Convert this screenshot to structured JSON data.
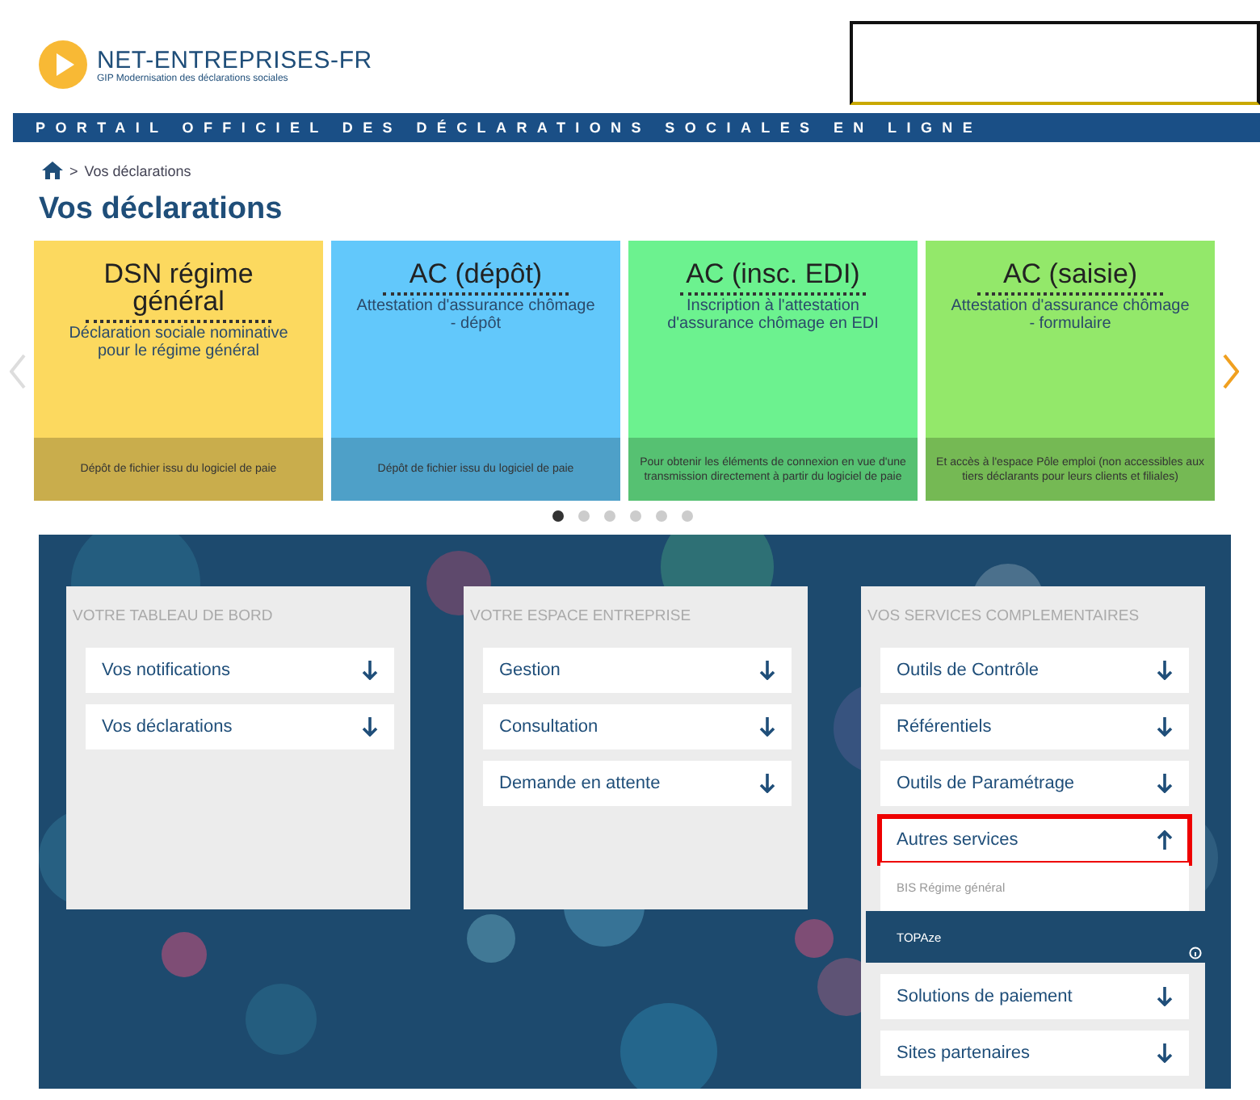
{
  "header": {
    "logo_title": "NET-ENTREPRISES-FR",
    "logo_subtitle": "GIP Modernisation des déclarations sociales",
    "banner": "PORTAIL OFFICIEL DES DÉCLARATIONS SOCIALES EN LIGNE"
  },
  "breadcrumb": {
    "separator": ">",
    "current": "Vos déclarations"
  },
  "page_title": "Vos déclarations",
  "cards": [
    {
      "title": "DSN régime général",
      "subtitle": "Déclaration sociale nominative pour le régime général",
      "footer": "Dépôt de fichier issu du logiciel de paie",
      "color": "#fcd95f"
    },
    {
      "title": "AC (dépôt)",
      "subtitle": "Attestation d'assurance chômage - dépôt",
      "footer": "Dépôt de fichier issu du logiciel de paie",
      "color": "#62c8fb"
    },
    {
      "title": "AC (insc. EDI)",
      "subtitle": "Inscription à l'attestation d'assurance chômage en EDI",
      "footer": "Pour obtenir les éléments de connexion en vue d'une transmission directement à partir du logiciel de paie",
      "color": "#6cf28f"
    },
    {
      "title": "AC (saisie)",
      "subtitle": "Attestation d'assurance chômage - formulaire",
      "footer": "Et accès à l'espace Pôle emploi (non accessibles aux tiers déclarants pour leurs clients et filiales)",
      "color": "#93e86a"
    }
  ],
  "carousel_dots": [
    {
      "selected": true
    },
    {
      "selected": false
    },
    {
      "selected": false
    },
    {
      "selected": false
    },
    {
      "selected": false
    },
    {
      "selected": false
    }
  ],
  "panels": [
    {
      "title": "VOTRE TABLEAU DE BORD",
      "items": [
        {
          "label": "Vos notifications",
          "expanded": false,
          "outlined": false
        },
        {
          "label": "Vos déclarations",
          "expanded": false,
          "outlined": false
        }
      ]
    },
    {
      "title": "VOTRE ESPACE ENTREPRISE",
      "items": [
        {
          "label": "Gestion",
          "expanded": false,
          "outlined": false
        },
        {
          "label": "Consultation",
          "expanded": false,
          "outlined": false
        },
        {
          "label": "Demande en attente",
          "expanded": false,
          "outlined": false
        }
      ]
    },
    {
      "title": "VOS SERVICES COMPLEMENTAIRES",
      "items": [
        {
          "label": "Outils de Contrôle",
          "expanded": false,
          "outlined": false
        },
        {
          "label": "Référentiels",
          "expanded": false,
          "outlined": false
        },
        {
          "label": "Outils de Paramétrage",
          "expanded": false,
          "outlined": false
        },
        {
          "label": "Autres services",
          "expanded": true,
          "outlined": true,
          "children": [
            {
              "label": "BIS Régime général",
              "selected": false
            },
            {
              "label": "TOPAze",
              "selected": true
            }
          ]
        },
        {
          "label": "Solutions de paiement",
          "expanded": false,
          "outlined": false
        },
        {
          "label": "Sites partenaires",
          "expanded": false,
          "outlined": false
        }
      ]
    }
  ]
}
